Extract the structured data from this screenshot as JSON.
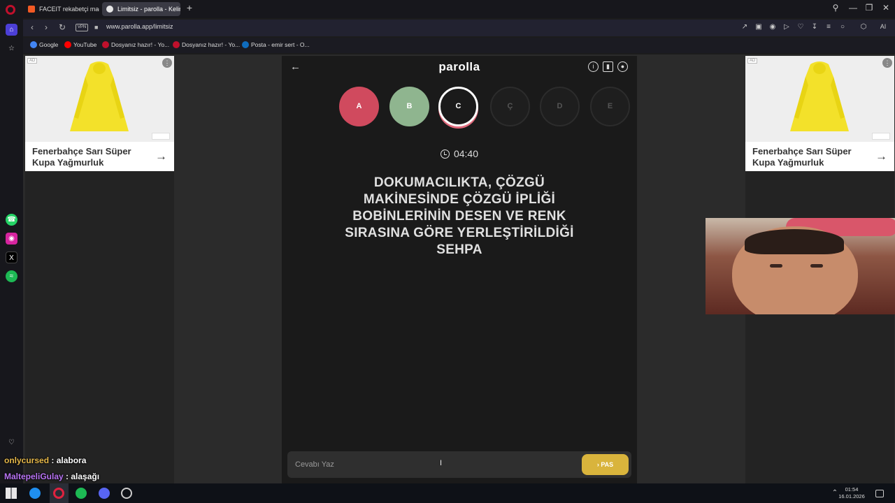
{
  "browser": {
    "tabs": [
      {
        "label": "FACEIT rekabetçi maç - FA"
      },
      {
        "label": "Limitsiz - parolla - Kelime"
      }
    ],
    "url": "www.parolla.app/limitsiz",
    "vpn_label": "VPN",
    "ai_label": "AI",
    "bookmarks": [
      {
        "label": "Google",
        "color": "#4285f4"
      },
      {
        "label": "YouTube",
        "color": "#ff0000"
      },
      {
        "label": "Dosyanız hazır! - Yo...",
        "color": "#c0102c"
      },
      {
        "label": "Dosyanız hazır! - Yo...",
        "color": "#c0102c"
      },
      {
        "label": "Posta - emir sert - O...",
        "color": "#0f6cbd"
      }
    ]
  },
  "ads": {
    "badge": "AD",
    "title": "Fenerbahçe Sarı Süper Kupa Yağmurluk"
  },
  "game": {
    "brand": "parolla",
    "letters": [
      {
        "label": "A",
        "state": "wrong",
        "color": "#d04a5e"
      },
      {
        "label": "B",
        "state": "correct",
        "color": "#8fb58f"
      },
      {
        "label": "C",
        "state": "current",
        "color": "#1a1a1a"
      },
      {
        "label": "Ç",
        "state": "pending",
        "color": "#1e1e1e"
      },
      {
        "label": "D",
        "state": "pending",
        "color": "#1e1e1e"
      },
      {
        "label": "E",
        "state": "pending",
        "color": "#1e1e1e"
      }
    ],
    "timer": "04:40",
    "question": "DOKUMACILIKTA, ÇÖZGÜ MAKİNESİNDE ÇÖZGÜ İPLİĞİ BOBİNLERİNİN DESEN VE RENK SIRASINA GÖRE YERLEŞTİRİLDİĞİ SEHPA",
    "answer_placeholder": "Cevabı Yaz",
    "pass_label": "PAS"
  },
  "chat": [
    {
      "user": "onlycursed",
      "message": ": alabora"
    },
    {
      "user": "MaltepeliGulay",
      "message": ": alaşağı"
    }
  ],
  "taskbar": {
    "time": "01:54",
    "date": "16.01.2026"
  }
}
